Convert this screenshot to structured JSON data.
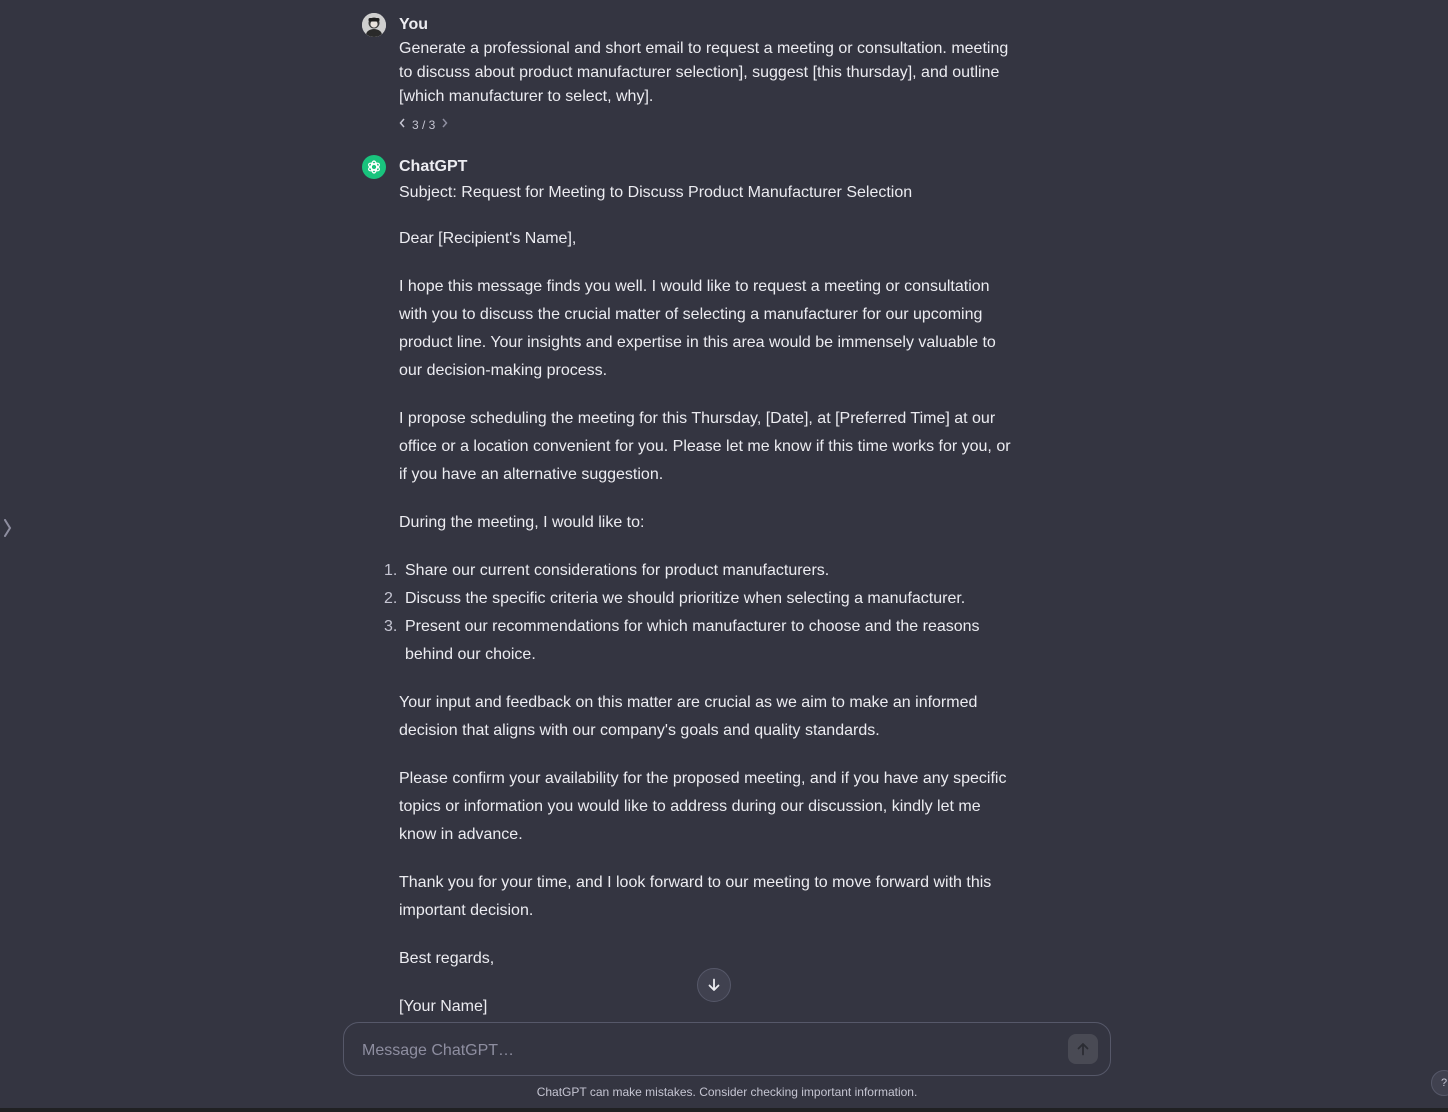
{
  "sidebar": {
    "toggle_icon": "sidebar-toggle-icon"
  },
  "user_message": {
    "author": "You",
    "text": "Generate a professional and short email to request a meeting or consultation. meeting to discuss about product manufacturer selection], suggest [this thursday], and outline [which manufacturer to select, why].",
    "pager": "3 / 3"
  },
  "assistant_message": {
    "author": "ChatGPT",
    "subject": "Subject: Request for Meeting to Discuss Product Manufacturer Selection",
    "greeting": "Dear [Recipient's Name],",
    "para1": "I hope this message finds you well. I would like to request a meeting or consultation with you to discuss the crucial matter of selecting a manufacturer for our upcoming product line. Your insights and expertise in this area would be immensely valuable to our decision-making process.",
    "para2": "I propose scheduling the meeting for this Thursday, [Date], at [Preferred Time] at our office or a location convenient for you. Please let me know if this time works for you, or if you have an alternative suggestion.",
    "para3": "During the meeting, I would like to:",
    "list": [
      {
        "num": "1.",
        "text": "Share our current considerations for product manufacturers."
      },
      {
        "num": "2.",
        "text": "Discuss the specific criteria we should prioritize when selecting a manufacturer."
      },
      {
        "num": "3.",
        "text": "Present our recommendations for which manufacturer to choose and the reasons behind our choice."
      }
    ],
    "para4": "Your input and feedback on this matter are crucial as we aim to make an informed decision that aligns with our company's goals and quality standards.",
    "para5": "Please confirm your availability for the proposed meeting, and if you have any specific topics or information you would like to address during our discussion, kindly let me know in advance.",
    "para6": "Thank you for your time, and I look forward to our meeting to move forward with this important decision.",
    "closing": "Best regards,",
    "signature": "[Your Name]"
  },
  "composer": {
    "placeholder": "Message ChatGPT…",
    "value": ""
  },
  "disclaimer": "ChatGPT can make mistakes. Consider checking important information.",
  "help_label": "?",
  "colors": {
    "background": "#343541",
    "text": "#ececf1",
    "muted": "#8e8ea0",
    "gpt_accent": "#19c37d",
    "border": "#565869"
  }
}
